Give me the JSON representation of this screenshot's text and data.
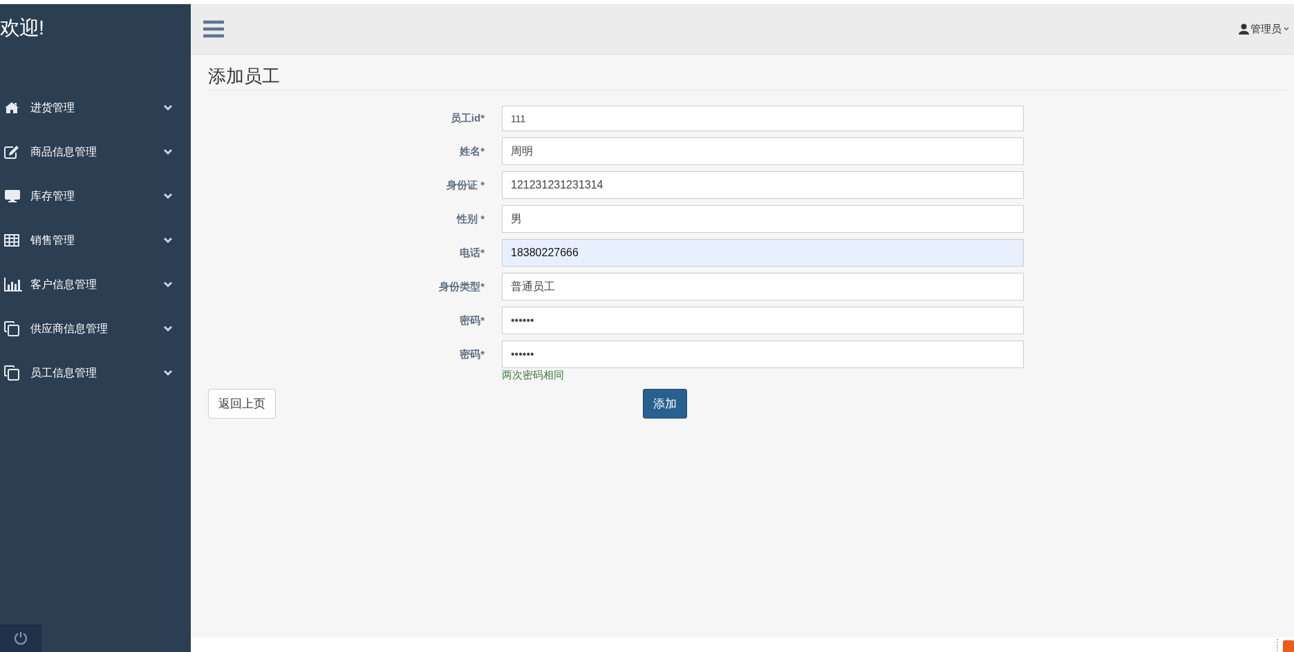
{
  "sidebar": {
    "title": "欢迎!",
    "items": [
      {
        "label": "进货管理",
        "expanded": false
      },
      {
        "label": "商品信息管理",
        "expanded": false
      },
      {
        "label": "库存管理",
        "expanded": false
      },
      {
        "label": "销售管理",
        "expanded": false
      },
      {
        "label": "客户信息管理",
        "expanded": false
      },
      {
        "label": "供应商信息管理",
        "expanded": false
      },
      {
        "label": "员工信息管理",
        "expanded": false
      }
    ]
  },
  "topbar": {
    "user": "管理员"
  },
  "page": {
    "title": "添加员工"
  },
  "form": {
    "fields": [
      {
        "label": "员工id*",
        "value": "111",
        "focused": false
      },
      {
        "label": "姓名*",
        "value": "周明",
        "focused": false
      },
      {
        "label": "身份证 *",
        "value": "121231231231314",
        "focused": false
      },
      {
        "label": "性别 *",
        "value": "男",
        "focused": false
      },
      {
        "label": "电话*",
        "value": "18380227666",
        "focused": true
      },
      {
        "label": "身份类型*",
        "value": "普通员工",
        "focused": false
      },
      {
        "label": "密码*",
        "value": "••••••",
        "focused": false
      },
      {
        "label": "密码*",
        "value": "••••••",
        "focused": false
      }
    ],
    "hint": "两次密码相同",
    "back_button": "返回上页",
    "submit_button": "添加"
  }
}
